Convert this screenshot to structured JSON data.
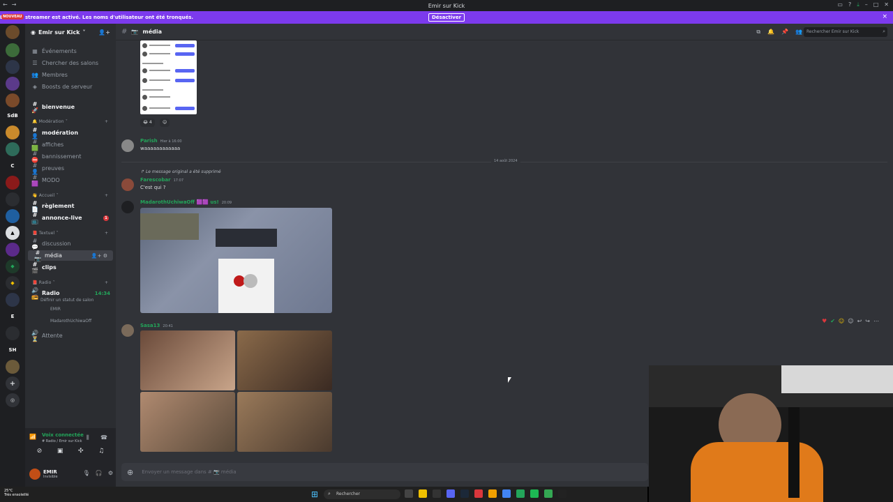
{
  "window": {
    "title": "Emir sur Kick"
  },
  "notice": {
    "message": "Le mode streamer est activé. Les noms d'utilisateur ont été tronqués.",
    "button": "Désactiver",
    "close": "×"
  },
  "servers": {
    "new_badge": "NOUVEAU",
    "labels": [
      "SdB",
      "C",
      "E",
      "SH"
    ]
  },
  "guild": {
    "name": "Emir sur Kick",
    "top_items": [
      "Événements",
      "Chercher des salons",
      "Membres",
      "Boosts de serveur"
    ],
    "channels": [
      {
        "name": "bienvenue",
        "prefix": "# 🚀"
      },
      {
        "name": "modération",
        "prefix": "# 👤"
      },
      {
        "name": "affiches",
        "prefix": "# 🟩"
      },
      {
        "name": "bannissement",
        "prefix": "# ⛔"
      },
      {
        "name": "preuves",
        "prefix": "# 👤"
      },
      {
        "name": "MODO",
        "prefix": "# 🟪"
      },
      {
        "name": "règlement",
        "prefix": "# 📄"
      },
      {
        "name": "annonce-live",
        "prefix": "# 📺"
      },
      {
        "name": "discussion",
        "prefix": "# 💬"
      },
      {
        "name": "média",
        "prefix": "# 📷"
      },
      {
        "name": "clips",
        "prefix": "# 🎬"
      },
      {
        "name": "Radio",
        "prefix": "🔊 📻"
      },
      {
        "name": "Attente",
        "prefix": "🔊 ⏳"
      }
    ],
    "categories": [
      "Modération",
      "Accueil",
      "Textuel",
      "Radio"
    ],
    "radio_time": "14:34",
    "radio_status": "Définir un statut de salon",
    "voice_users": [
      "EMIR",
      "MadarothUchiwaOff"
    ],
    "annonce_badge": "1"
  },
  "voice_panel": {
    "status": "Voix connectée",
    "location": "# Radio / Emir sur Kick"
  },
  "user": {
    "name": "EMIR",
    "status": "Invisible"
  },
  "topbar": {
    "channel": "média",
    "search_placeholder": "Rechercher Emir sur Kick"
  },
  "messages": {
    "reaction_count": "4",
    "parish": {
      "name": "Parish",
      "time": "Hier à 16:00",
      "text": "waaaaaaaaaaaa"
    },
    "date_divider": "14 août 2024",
    "reply_note": "Le message original a été supprimé",
    "farescobar": {
      "name": "Farescobar",
      "time": "17:07",
      "text": "C'est qui ?"
    },
    "madaroth": {
      "name": "MadarothUchiwaOff",
      "tag": "us!",
      "time": "20:09"
    },
    "sasa": {
      "name": "Sasa13",
      "time": "20:41"
    }
  },
  "composer": {
    "placeholder": "Envoyer un message dans # 📷 média"
  },
  "taskbar": {
    "weather_temp": "25°C",
    "weather_desc": "Très ensoleillé",
    "search": "Rechercher"
  },
  "colors": {
    "accent": "#7c3aed",
    "online": "#23a55a",
    "danger": "#da373c"
  }
}
